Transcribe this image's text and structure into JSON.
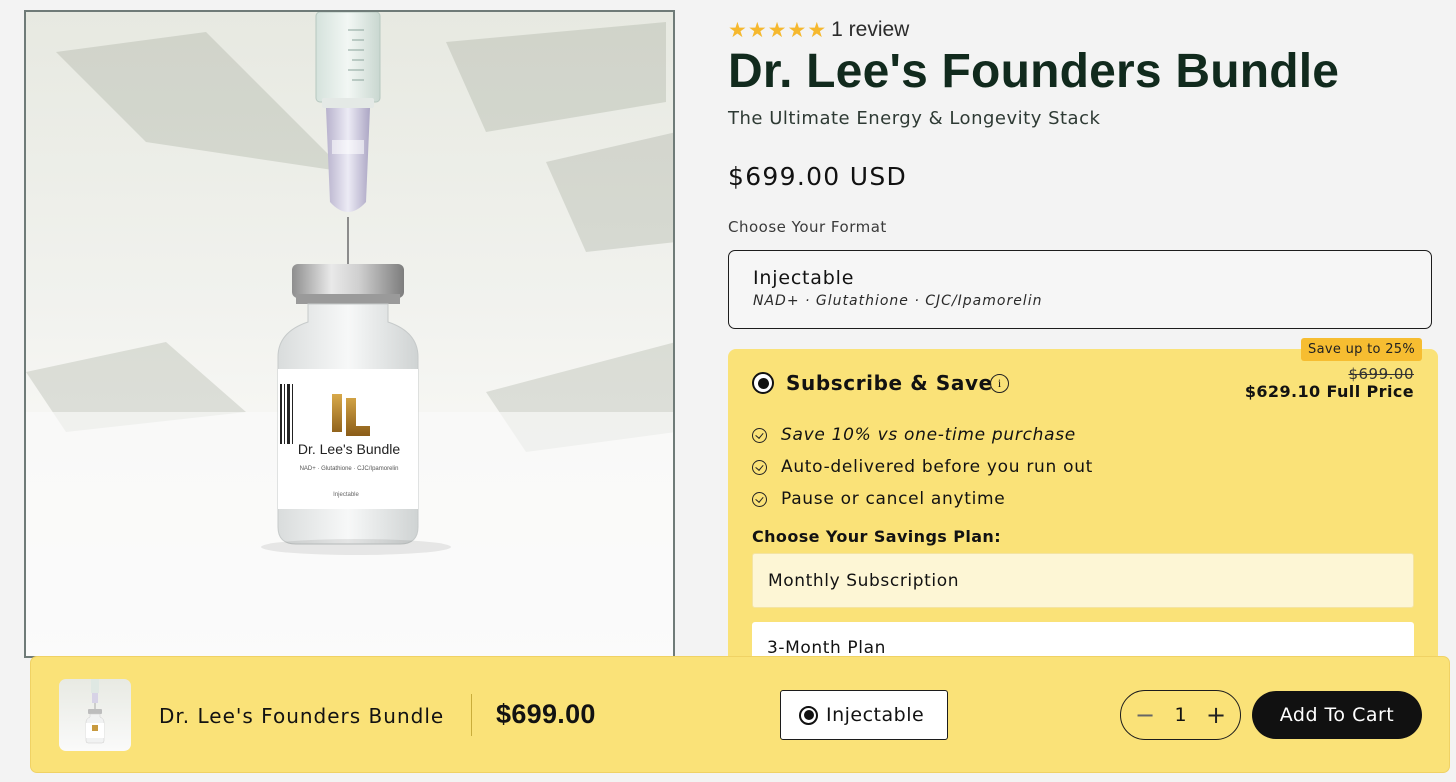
{
  "product": {
    "stars": [
      "★",
      "★",
      "★",
      "★",
      "★"
    ],
    "review_count": "1 review",
    "title": "Dr. Lee's Founders Bundle",
    "subtitle": "The Ultimate Energy & Longevity Stack",
    "price": "$699.00 USD",
    "image_label": {
      "brand": "Dr. Lee's Bundle",
      "ingredients": "NAD+ · Glutathione · CJC/Ipamorelin",
      "format": "Injectable"
    }
  },
  "format": {
    "label": "Choose Your Format",
    "selected_name": "Injectable",
    "selected_details": "NAD+ · Glutathione · CJC/Ipamorelin"
  },
  "subscribe": {
    "badge": "Save up to 25%",
    "title": "Subscribe & Save",
    "old_price": "$699.00",
    "full_price": "$629.10 Full Price",
    "benefit_1_emphasis": "Save 10%",
    "benefit_1_rest": " vs one-time purchase",
    "benefit_2": "Auto-delivered before you run out",
    "benefit_3": "Pause or cancel anytime",
    "plan_label": "Choose Your Savings Plan:",
    "plans": [
      "Monthly Subscription",
      "3-Month Plan"
    ]
  },
  "sticky_bar": {
    "title": "Dr. Lee's Founders Bundle",
    "price": "$699.00",
    "format": "Injectable",
    "quantity": "1",
    "minus": "−",
    "plus": "+",
    "add_to_cart": "Add To Cart"
  },
  "colors": {
    "accent_yellow": "#fae278",
    "badge_yellow": "#f6bd31",
    "title_green": "#112a1d",
    "star": "#f5b82e"
  }
}
